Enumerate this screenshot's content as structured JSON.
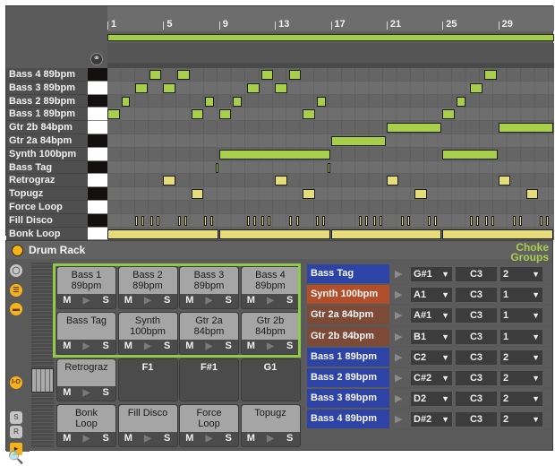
{
  "arrangement": {
    "ruler": [
      "1",
      "5",
      "9",
      "13",
      "17",
      "21",
      "25",
      "29"
    ],
    "total_bars": 32,
    "lanes": [
      {
        "label": "Bass 4 89bpm",
        "key": "black",
        "notes": [
          {
            "start": 4,
            "len": 1
          },
          {
            "start": 6,
            "len": 1
          },
          {
            "start": 12,
            "len": 1
          },
          {
            "start": 14,
            "len": 1
          },
          {
            "start": 28,
            "len": 1
          }
        ],
        "color": "green"
      },
      {
        "label": "Bass 3 89bpm",
        "key": "white",
        "notes": [
          {
            "start": 3,
            "len": 1
          },
          {
            "start": 5,
            "len": 1
          },
          {
            "start": 11,
            "len": 1
          },
          {
            "start": 13,
            "len": 1
          },
          {
            "start": 27,
            "len": 1
          }
        ],
        "color": "green"
      },
      {
        "label": "Bass 2 89bpm",
        "key": "black",
        "notes": [
          {
            "start": 2,
            "len": 0.75
          },
          {
            "start": 8,
            "len": 0.75
          },
          {
            "start": 10,
            "len": 0.75
          },
          {
            "start": 16,
            "len": 0.75
          },
          {
            "start": 26,
            "len": 0.75
          }
        ],
        "color": "green"
      },
      {
        "label": "Bass 1 89bpm",
        "key": "white",
        "notes": [
          {
            "start": 1,
            "len": 1
          },
          {
            "start": 7,
            "len": 1
          },
          {
            "start": 9,
            "len": 1
          },
          {
            "start": 15,
            "len": 1
          },
          {
            "start": 25,
            "len": 1
          }
        ],
        "color": "green"
      },
      {
        "label": "Gtr 2b 84bpm",
        "key": "white",
        "notes": [
          {
            "start": 21,
            "len": 4
          },
          {
            "start": 29,
            "len": 4
          }
        ],
        "color": "green"
      },
      {
        "label": "Gtr 2a 84bpm",
        "key": "black",
        "notes": [
          {
            "start": 17,
            "len": 4
          }
        ],
        "color": "green"
      },
      {
        "label": "Synth 100bpm",
        "key": "white",
        "notes": [
          {
            "start": 9,
            "len": 8
          },
          {
            "start": 25,
            "len": 4
          }
        ],
        "color": "green"
      },
      {
        "label": "Bass Tag",
        "key": "black",
        "notes": [
          {
            "start": 8.75,
            "len": 0.3
          },
          {
            "start": 16.75,
            "len": 0.3
          }
        ],
        "color": "green"
      },
      {
        "label": "Retrograz",
        "key": "white",
        "notes": [
          {
            "start": 5,
            "len": 1
          },
          {
            "start": 13,
            "len": 1
          },
          {
            "start": 21,
            "len": 1
          },
          {
            "start": 29,
            "len": 1
          }
        ],
        "color": "yellow"
      },
      {
        "label": "Topugz",
        "key": "black",
        "notes": [
          {
            "start": 7,
            "len": 1
          },
          {
            "start": 15,
            "len": 1
          },
          {
            "start": 23,
            "len": 1
          },
          {
            "start": 31,
            "len": 1
          }
        ],
        "color": "yellow"
      },
      {
        "label": "Force Loop",
        "key": "white",
        "notes": [],
        "color": "yellow"
      },
      {
        "label": "Fill Disco",
        "key": "black",
        "notes": [
          {
            "start": 3.0,
            "len": 0.3
          },
          {
            "start": 3.45,
            "len": 0.3
          },
          {
            "start": 4.05,
            "len": 0.3
          },
          {
            "start": 4.5,
            "len": 0.3
          },
          {
            "start": 6.05,
            "len": 0.3
          },
          {
            "start": 6.5,
            "len": 0.3
          },
          {
            "start": 7.95,
            "len": 0.3
          },
          {
            "start": 8.4,
            "len": 0.3
          },
          {
            "start": 11.0,
            "len": 0.3
          },
          {
            "start": 11.45,
            "len": 0.3
          },
          {
            "start": 12.05,
            "len": 0.3
          },
          {
            "start": 12.5,
            "len": 0.3
          },
          {
            "start": 14.05,
            "len": 0.3
          },
          {
            "start": 14.5,
            "len": 0.3
          },
          {
            "start": 15.95,
            "len": 0.3
          },
          {
            "start": 16.4,
            "len": 0.3
          },
          {
            "start": 19.0,
            "len": 0.3
          },
          {
            "start": 19.45,
            "len": 0.3
          },
          {
            "start": 20.05,
            "len": 0.3
          },
          {
            "start": 20.5,
            "len": 0.3
          },
          {
            "start": 22.05,
            "len": 0.3
          },
          {
            "start": 22.5,
            "len": 0.3
          },
          {
            "start": 23.95,
            "len": 0.3
          },
          {
            "start": 24.4,
            "len": 0.3
          },
          {
            "start": 27.0,
            "len": 0.3
          },
          {
            "start": 27.45,
            "len": 0.3
          },
          {
            "start": 28.05,
            "len": 0.3
          },
          {
            "start": 28.5,
            "len": 0.3
          },
          {
            "start": 30.05,
            "len": 0.3
          },
          {
            "start": 30.5,
            "len": 0.3
          },
          {
            "start": 31.95,
            "len": 0.3
          },
          {
            "start": 32.4,
            "len": 0.3
          }
        ],
        "color": "yellow"
      },
      {
        "label": "Bonk Loop",
        "key": "white",
        "notes": [
          {
            "start": 1,
            "len": 8
          },
          {
            "start": 9,
            "len": 8
          },
          {
            "start": 17,
            "len": 8
          },
          {
            "start": 25,
            "len": 8
          }
        ],
        "color": "yellow"
      }
    ]
  },
  "drum_rack": {
    "title": "Drum Rack",
    "choke_label_line1": "Choke",
    "choke_label_line2": "Groups",
    "side_icons": [
      "headphone-icon",
      "chain-list-icon",
      "macro-icon",
      "io-icon",
      "send-icon",
      "return-icon",
      "arrow-icon"
    ],
    "side_labels": {
      "io": "I-O",
      "s": "S",
      "r": "R"
    },
    "pad_controls": {
      "mute": "M",
      "play": "▶",
      "solo": "S"
    },
    "pads": [
      {
        "name": "Bass 1\n89bpm",
        "filled": true
      },
      {
        "name": "Bass 2\n89bpm",
        "filled": true
      },
      {
        "name": "Bass 3\n89bpm",
        "filled": true
      },
      {
        "name": "Bass 4\n89bpm",
        "filled": true
      },
      {
        "name": "Bass Tag",
        "filled": true
      },
      {
        "name": "Synth\n100bpm",
        "filled": true
      },
      {
        "name": "Gtr 2a\n84bpm",
        "filled": true
      },
      {
        "name": "Gtr 2b\n84bpm",
        "filled": true
      },
      {
        "name": "Retrograz",
        "filled": true
      },
      {
        "name": "F1",
        "filled": false
      },
      {
        "name": "F#1",
        "filled": false
      },
      {
        "name": "G1",
        "filled": false
      },
      {
        "name": "Bonk\nLoop",
        "filled": true
      },
      {
        "name": "Fill Disco",
        "filled": true
      },
      {
        "name": "Force\nLoop",
        "filled": true
      },
      {
        "name": "Topugz",
        "filled": true
      }
    ],
    "chains": [
      {
        "name": "Bass Tag",
        "color": "#2d44a6",
        "receive": "G#1",
        "play": "C3",
        "choke": "2"
      },
      {
        "name": "Synth 100bpm",
        "color": "#b24e2a",
        "receive": "A1",
        "play": "C3",
        "choke": "1"
      },
      {
        "name": "Gtr 2a 84bpm",
        "color": "#7d4a37",
        "receive": "A#1",
        "play": "C3",
        "choke": "1"
      },
      {
        "name": "Gtr 2b 84bpm",
        "color": "#7d4a37",
        "receive": "B1",
        "play": "C3",
        "choke": "1"
      },
      {
        "name": "Bass 1 89bpm",
        "color": "#2d44a6",
        "receive": "C2",
        "play": "C3",
        "choke": "2"
      },
      {
        "name": "Bass 2 89bpm",
        "color": "#2d44a6",
        "receive": "C#2",
        "play": "C3",
        "choke": "2"
      },
      {
        "name": "Bass 3 89bpm",
        "color": "#2d44a6",
        "receive": "D2",
        "play": "C3",
        "choke": "2"
      },
      {
        "name": "Bass 4 89bpm",
        "color": "#2d44a6",
        "receive": "D#2",
        "play": "C3",
        "choke": "2"
      }
    ]
  },
  "colors": {
    "note_green": "#a8cf4a",
    "note_yellow": "#e6dc7a",
    "accent_orange": "#f6b21b",
    "selection_green": "#8fca48"
  }
}
